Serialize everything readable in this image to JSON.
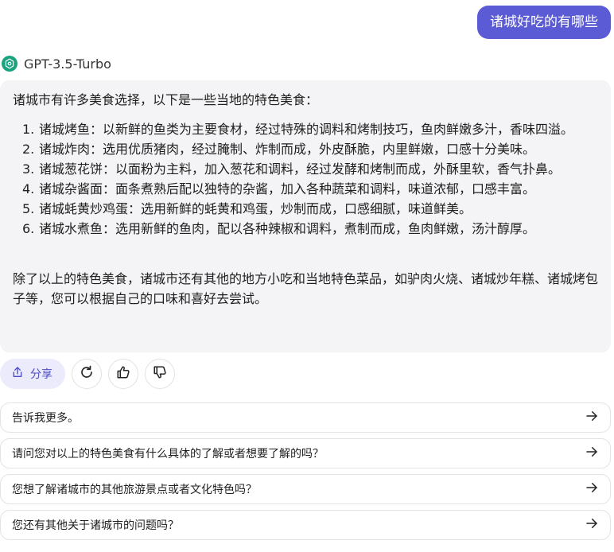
{
  "user_message": "诸城好吃的有哪些",
  "model": {
    "name": "GPT-3.5-Turbo",
    "logo_icon": "openai-logo-icon",
    "logo_color": "#19a37f"
  },
  "answer": {
    "intro": "诸城市有许多美食选择，以下是一些当地的特色美食：",
    "items": [
      {
        "num": "1.",
        "text": "诸城烤鱼：以新鲜的鱼类为主要食材，经过特殊的调料和烤制技巧，鱼肉鲜嫩多汁，香味四溢。"
      },
      {
        "num": "2.",
        "text": "诸城炸肉：选用优质猪肉，经过腌制、炸制而成，外皮酥脆，内里鲜嫩，口感十分美味。"
      },
      {
        "num": "3.",
        "text": "诸城葱花饼：以面粉为主料，加入葱花和调料，经过发酵和烤制而成，外酥里软，香气扑鼻。"
      },
      {
        "num": "4.",
        "text": "诸城杂酱面：面条煮熟后配以独特的杂酱，加入各种蔬菜和调料，味道浓郁，口感丰富。"
      },
      {
        "num": "5.",
        "text": "诸城蚝黄炒鸡蛋：选用新鲜的蚝黄和鸡蛋，炒制而成，口感细腻，味道鲜美。"
      },
      {
        "num": "6.",
        "text": "诸城水煮鱼：选用新鲜的鱼肉，配以各种辣椒和调料，煮制而成，鱼肉鲜嫩，汤汁醇厚。"
      }
    ],
    "outro": "除了以上的特色美食，诸城市还有其他的地方小吃和当地特色菜品，如驴肉火烧、诸城炒年糕、诸城烤包子等，您可以根据自己的口味和喜好去尝试。"
  },
  "actions": {
    "share_label": "分享",
    "share_icon": "share-icon",
    "regenerate_icon": "refresh-icon",
    "like_icon": "thumbs-up-icon",
    "dislike_icon": "thumbs-down-icon"
  },
  "suggestions": [
    "告诉我更多。",
    "请问您对以上的特色美食有什么具体的了解或者想要了解的吗？",
    "您想了解诸城市的其他旅游景点或者文化特色吗？",
    "您还有其他关于诸城市的问题吗？"
  ],
  "colors": {
    "accent": "#5b5bd6",
    "share_bg": "#ebebfb",
    "card_bg": "#f4f4f6"
  }
}
